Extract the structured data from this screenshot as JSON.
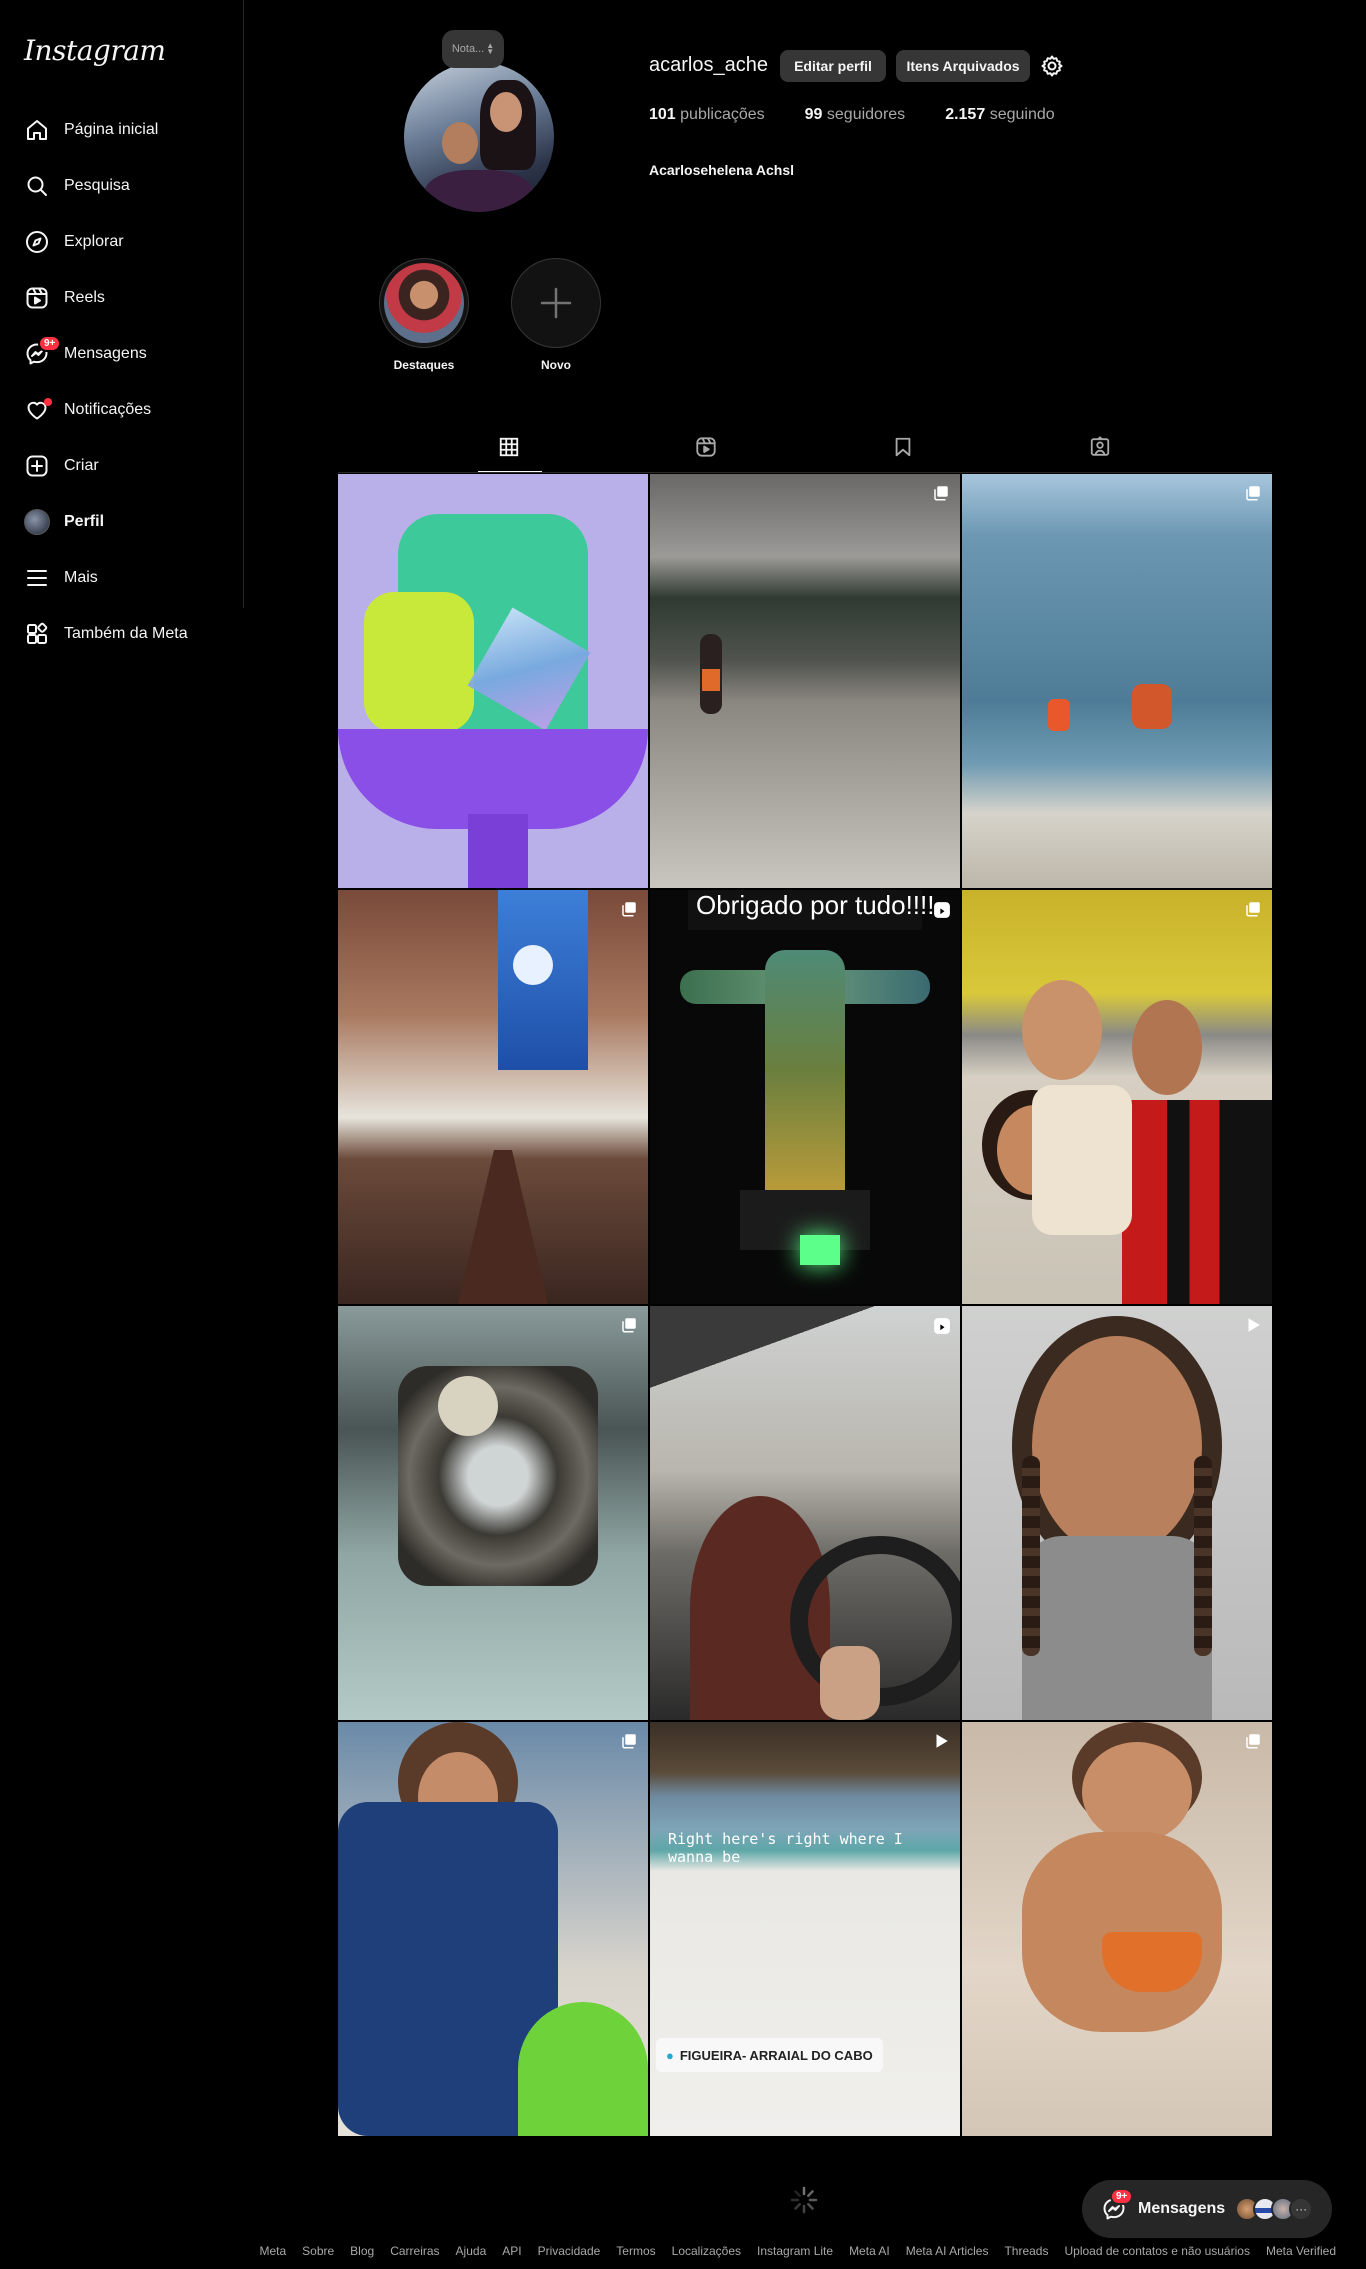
{
  "app": {
    "logo_text": "Instagram"
  },
  "sidebar": {
    "items": [
      {
        "label": "Página inicial",
        "icon": "home-icon"
      },
      {
        "label": "Pesquisa",
        "icon": "search-icon"
      },
      {
        "label": "Explorar",
        "icon": "compass-icon"
      },
      {
        "label": "Reels",
        "icon": "reels-icon"
      },
      {
        "label": "Mensagens",
        "icon": "messenger-icon",
        "badge": "9+"
      },
      {
        "label": "Notificações",
        "icon": "heart-icon"
      },
      {
        "label": "Criar",
        "icon": "plus-square-icon"
      },
      {
        "label": "Perfil",
        "icon": "avatar"
      },
      {
        "label": "Mais",
        "icon": "hamburger-icon"
      },
      {
        "label": "Também da Meta",
        "icon": "meta-apps-icon"
      }
    ]
  },
  "profile": {
    "note_placeholder": "Nota...",
    "username": "acarlos_ache",
    "edit_button": "Editar perfil",
    "archive_button": "Itens Arquivados",
    "posts_count": "101",
    "posts_label": "publicações",
    "followers_count": "99",
    "followers_label": "seguidores",
    "following_count": "2.157",
    "following_label": "seguindo",
    "full_name": "Acarlosehelena Achsl"
  },
  "highlights": [
    {
      "label": "Destaques"
    },
    {
      "label": "Novo"
    }
  ],
  "tabs": [
    {
      "icon": "grid-icon",
      "active": true
    },
    {
      "icon": "reels-icon",
      "active": false
    },
    {
      "icon": "bookmark-icon",
      "active": false
    },
    {
      "icon": "tagged-icon",
      "active": false
    }
  ],
  "posts": [
    {
      "kind": "image",
      "indicator": ""
    },
    {
      "kind": "carousel",
      "indicator": "carousel-icon"
    },
    {
      "kind": "carousel",
      "indicator": "carousel-icon"
    },
    {
      "kind": "carousel",
      "indicator": "carousel-icon"
    },
    {
      "kind": "reel",
      "indicator": "reel-icon",
      "overlay_text": "Obrigado por tudo!!!!"
    },
    {
      "kind": "carousel",
      "indicator": "carousel-icon"
    },
    {
      "kind": "carousel",
      "indicator": "carousel-icon"
    },
    {
      "kind": "reel",
      "indicator": "reel-icon"
    },
    {
      "kind": "video",
      "indicator": "play-icon"
    },
    {
      "kind": "carousel",
      "indicator": "carousel-icon"
    },
    {
      "kind": "video",
      "indicator": "play-icon",
      "overlay_text": "Right here's right where I wanna be",
      "location_text": "FIGUEIRA- ARRAIAL DO CABO"
    },
    {
      "kind": "carousel",
      "indicator": "carousel-icon"
    }
  ],
  "footer": {
    "links": [
      "Meta",
      "Sobre",
      "Blog",
      "Carreiras",
      "Ajuda",
      "API",
      "Privacidade",
      "Termos",
      "Localizações",
      "Instagram Lite",
      "Meta AI",
      "Meta AI Articles",
      "Threads",
      "Upload de contatos e não usuários",
      "Meta Verified"
    ]
  },
  "messages_pill": {
    "label": "Mensagens",
    "badge": "9+",
    "more": "···"
  },
  "colors": {
    "background": "#000000",
    "surface": "#363636",
    "badge": "#ff3040",
    "text": "#f5f5f5",
    "muted": "#a8a8a8"
  }
}
